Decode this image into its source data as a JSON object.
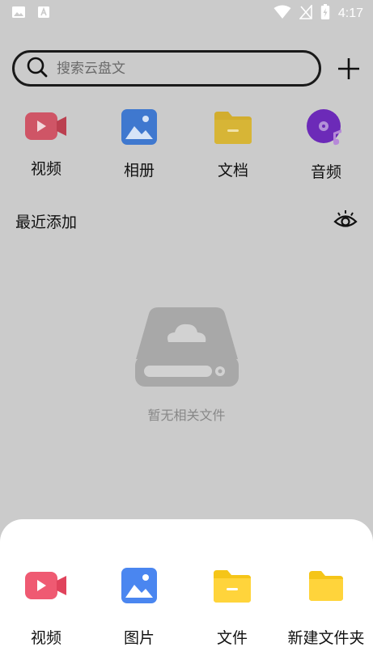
{
  "status_bar": {
    "time": "4:17",
    "left_icons": [
      "image-icon",
      "a-box-icon"
    ],
    "right_icons": [
      "wifi-icon",
      "no-signal-icon",
      "battery-charging-icon"
    ]
  },
  "search": {
    "placeholder": "搜索云盘文"
  },
  "categories": [
    {
      "label": "视频",
      "icon": "video-icon"
    },
    {
      "label": "相册",
      "icon": "album-icon"
    },
    {
      "label": "文档",
      "icon": "document-folder-icon"
    },
    {
      "label": "音频",
      "icon": "audio-disc-icon"
    }
  ],
  "recent": {
    "title": "最近添加"
  },
  "empty_state": {
    "text": "暂无相关文件",
    "icon": "cloud-drive-icon"
  },
  "upload_sheet": {
    "items": [
      {
        "label": "视频",
        "icon": "video-icon"
      },
      {
        "label": "图片",
        "icon": "image-icon"
      },
      {
        "label": "文件",
        "icon": "file-folder-icon"
      },
      {
        "label": "新建文件夹",
        "icon": "new-folder-icon"
      }
    ]
  },
  "colors": {
    "overlay": "#cbcbcb",
    "video": "#ef5a72",
    "image": "#4a86f0",
    "folder": "#ffd43b",
    "audio": "#7a34d8"
  }
}
